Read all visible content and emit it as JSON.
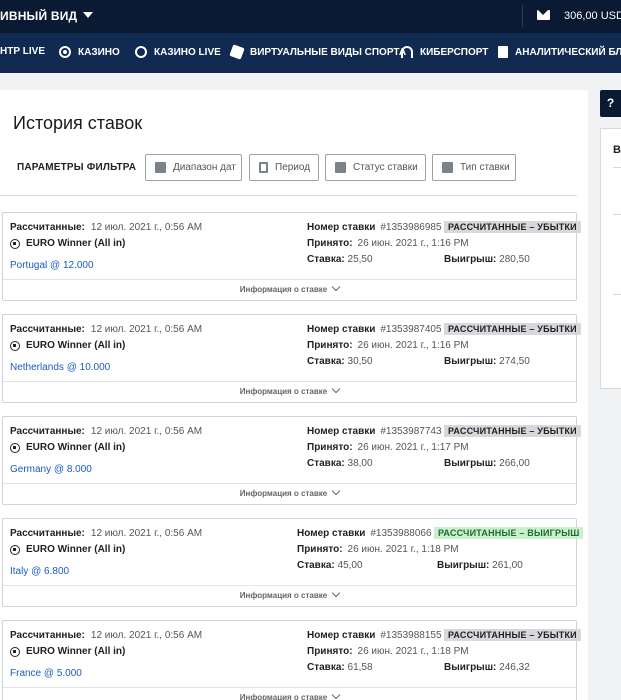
{
  "topbar": {
    "view_label": "ИВНЫЙ ВИД",
    "balance": "306,00 USD"
  },
  "nav": [
    {
      "label": "НТР LIVE",
      "icon": "none"
    },
    {
      "label": "КАЗИНО",
      "icon": "chip-icon"
    },
    {
      "label": "КАЗИНО LIVE",
      "icon": "live-casino-icon"
    },
    {
      "label": "ВИРТУАЛЬНЫЕ ВИДЫ СПОРТА",
      "icon": "dice-icon"
    },
    {
      "label": "КИБЕРСПОРТ",
      "icon": "headset-icon"
    },
    {
      "label": "АНАЛИТИЧЕСКИЙ БЛОГ",
      "icon": "document-icon"
    }
  ],
  "page": {
    "title": "История ставок",
    "filter_label": "ПАРАМЕТРЫ ФИЛЬТРА"
  },
  "filters": [
    {
      "label": "Диапазон дат",
      "icon": "calendar-icon"
    },
    {
      "label": "Период",
      "icon": "hourglass-icon"
    },
    {
      "label": "Статус ставки",
      "icon": "chart-icon"
    },
    {
      "label": "Тип ставки",
      "icon": "document-icon"
    }
  ],
  "labels": {
    "settled": "Рассчитанные:",
    "bet_number": "Номер ставки",
    "accepted": "Принято:",
    "stake": "Ставка:",
    "winnings": "Выигрыш:",
    "info": "Информация о ставке"
  },
  "bets": [
    {
      "settled_date": "12 июл. 2021 г., 0:56 AM",
      "event": "EURO Winner (All in)",
      "selection": "Portugal @ 12.000",
      "number": "#1353986985",
      "status": "РАССЧИТАННЫЕ – УБЫТКИ",
      "status_type": "loss",
      "accepted": "26 июн. 2021 г., 1:16 PM",
      "stake": "25,50",
      "winnings": "280,50"
    },
    {
      "settled_date": "12 июл. 2021 г., 0:56 AM",
      "event": "EURO Winner (All in)",
      "selection": "Netherlands @ 10.000",
      "number": "#1353987405",
      "status": "РАССЧИТАННЫЕ – УБЫТКИ",
      "status_type": "loss",
      "accepted": "26 июн. 2021 г., 1:16 PM",
      "stake": "30,50",
      "winnings": "274,50"
    },
    {
      "settled_date": "12 июл. 2021 г., 0:56 AM",
      "event": "EURO Winner (All in)",
      "selection": "Germany @ 8.000",
      "number": "#1353987743",
      "status": "РАССЧИТАННЫЕ – УБЫТКИ",
      "status_type": "loss",
      "accepted": "26 июн. 2021 г., 1:17 PM",
      "stake": "38,00",
      "winnings": "266,00"
    },
    {
      "settled_date": "12 июл. 2021 г., 0:56 AM",
      "event": "EURO Winner (All in)",
      "selection": "Italy @ 6.800",
      "number": "#1353988066",
      "status": "РАССЧИТАННЫЕ – ВЫИГРЫШ",
      "status_type": "win",
      "accepted": "26 июн. 2021 г., 1:18 PM",
      "stake": "45,00",
      "winnings": "261,00"
    },
    {
      "settled_date": "12 июл. 2021 г., 0:56 AM",
      "event": "EURO Winner (All in)",
      "selection": "France @ 5.000",
      "number": "#1353988155",
      "status": "РАССЧИТАННЫЕ – УБЫТКИ",
      "status_type": "loss",
      "accepted": "26 июн. 2021 г., 1:18 PM",
      "stake": "61,58",
      "winnings": "246,32"
    }
  ],
  "side": {
    "help": "?",
    "panel_letter": "В"
  },
  "colors": {
    "topbar": "#0b1a33",
    "navbar": "#102a52",
    "link": "#1a5cbf",
    "win_badge": "#c8f0cc",
    "loss_badge": "#d6d8db"
  }
}
